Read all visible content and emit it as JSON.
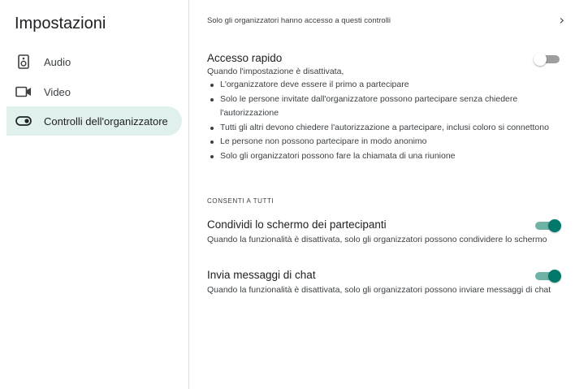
{
  "sidebar": {
    "title": "Impostazioni",
    "items": [
      {
        "label": "Audio",
        "icon": "speaker-icon",
        "active": false
      },
      {
        "label": "Video",
        "icon": "videocam-icon",
        "active": false
      },
      {
        "label": "Controlli dell'organizzatore",
        "icon": "toggle-icon",
        "active": true
      }
    ]
  },
  "main": {
    "notice": "Solo gli organizzatori hanno accesso a questi controlli",
    "notice_icon": "chevron-right-icon",
    "quick_access": {
      "title": "Accesso rapido",
      "description": "Quando l'impostazione è disattivata,",
      "toggle_on": false,
      "bullets": [
        "L'organizzatore deve essere il primo a partecipare",
        "Solo le persone invitate dall'organizzatore possono partecipare senza chiedere l'autorizzazione",
        "Tutti gli altri devono chiedere l'autorizzazione a partecipare, inclusi coloro si connettono",
        "Le persone non possono partecipare in modo anonimo",
        "Solo gli organizzatori possono fare la chiamata di una riunione"
      ]
    },
    "section_label": "CONSENTI A TUTTI",
    "share_screen": {
      "title": "Condividi lo schermo dei partecipanti",
      "description": "Quando la funzionalità è disattivata, solo gli organizzatori possono condividere lo schermo",
      "toggle_on": true
    },
    "chat": {
      "title": "Invia messaggi di chat",
      "description": "Quando la funzionalità è disattivata, solo gli organizzatori possono inviare messaggi di chat",
      "toggle_on": true
    }
  },
  "colors": {
    "accent": "#00796b",
    "accent_track": "#6fb3a6",
    "active_nav_bg": "#e0f0ec",
    "divider": "#dadce0"
  }
}
